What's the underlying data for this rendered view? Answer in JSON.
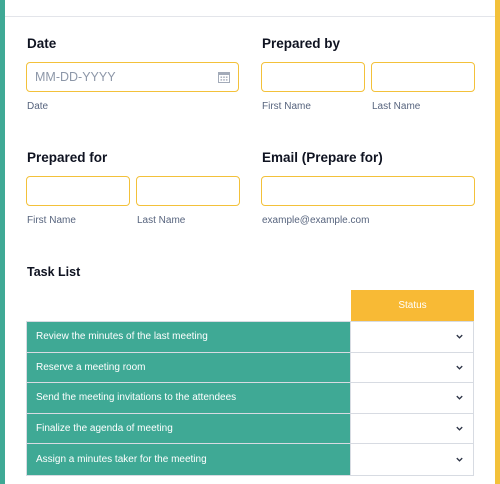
{
  "form": {
    "date": {
      "label": "Date",
      "placeholder": "MM-DD-YYYY",
      "sublabel": "Date",
      "icon": "calendar-icon"
    },
    "prepared_by": {
      "label": "Prepared by",
      "first_sublabel": "First Name",
      "last_sublabel": "Last Name"
    },
    "prepared_for": {
      "label": "Prepared for",
      "first_sublabel": "First Name",
      "last_sublabel": "Last Name"
    },
    "email": {
      "label": "Email (Prepare for)",
      "sublabel": "example@example.com"
    }
  },
  "task_list": {
    "title": "Task List",
    "status_header": "Status",
    "rows": [
      {
        "name": "Review the minutes of the last meeting",
        "status": ""
      },
      {
        "name": "Reserve a meeting room",
        "status": ""
      },
      {
        "name": "Send the meeting invitations to the attendees",
        "status": ""
      },
      {
        "name": "Finalize the agenda of meeting",
        "status": ""
      },
      {
        "name": "Assign a minutes taker for the meeting",
        "status": ""
      }
    ]
  },
  "colors": {
    "accent_green": "#3fa995",
    "accent_yellow": "#f3c13a",
    "status_header": "#f8ba35"
  }
}
